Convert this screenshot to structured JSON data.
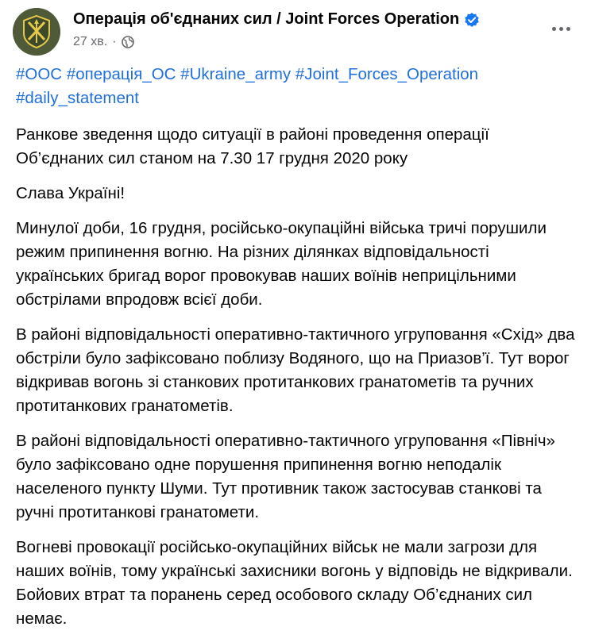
{
  "post": {
    "page_name": "Операція об'єднаних сил / Joint Forces Operation",
    "time": "27 хв.",
    "separator": "·",
    "hashtags": [
      "#ООС",
      "#операція_ОС",
      "#Ukraine_army",
      "#Joint_Forces_Operation",
      "#daily_statement"
    ],
    "paragraphs": [
      "Ранкове зведення щодо ситуації в районі проведення операції Об’єднаних сил станом на 7.30 17 грудня 2020 року",
      "Слава Україні!",
      "Минулої доби, 16 грудня, російсько-окупаційні війська тричі порушили режим припинення вогню. На різних ділянках відповідальності українських бригад ворог провокував наших воїнів неприцільними обстрілами впродовж всієї доби.",
      "В районі відповідальності оперативно-тактичного угруповання «Схід» два обстріли було зафіксовано поблизу Водяного, що на Приазов’ї. Тут ворог відкривав вогонь зі станкових протитанкових гранатометів та ручних протитанкових гранатометів.",
      "В районі відповідальності оперативно-тактичного угруповання «Північ» було зафіксовано одне порушення припинення вогню неподалік населеного пункту Шуми. Тут противник також застосував станкові та ручні протитанкові гранатомети.",
      "Вогневі провокації російсько-окупаційних військ не мали загрози для наших воїнів, тому українські захисники вогонь у відповідь не відкривали. Бойових втрат та поранень серед особового складу Об’єднаних сил немає."
    ],
    "icons": {
      "avatar": "jfo-emblem-icon",
      "verified": "verified-badge-icon",
      "audience": "globe-icon",
      "menu": "more-options-icon"
    },
    "colors": {
      "link": "#216fdb",
      "verified": "#1877f2",
      "meta": "#65676b",
      "avatar_bg": "#4f5a38",
      "emblem": "#e8c84a"
    }
  }
}
